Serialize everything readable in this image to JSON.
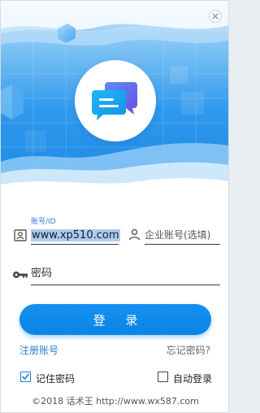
{
  "colors": {
    "accent": "#0a84e8",
    "hero_light": "#cfe8fb",
    "hero_mid": "#45aaf0",
    "hero_dark": "#1d7fd6"
  },
  "header": {
    "close_icon": "close-icon",
    "logo_icon": "chat-bubbles-icon"
  },
  "form": {
    "account_label": "账号/ID",
    "account_value": "www.xp510.com",
    "enterprise_placeholder": "企业账号(选填)",
    "password_placeholder": "密码",
    "account_icon": "contact-card-icon",
    "enterprise_icon": "person-icon",
    "password_icon": "key-icon"
  },
  "actions": {
    "login_label": "登 录",
    "register_link": "注册账号",
    "forgot_link": "忘记密码?"
  },
  "options": {
    "remember_label": "记住密码",
    "remember_checked": true,
    "auto_login_label": "自动登录",
    "auto_login_checked": false
  },
  "footer": {
    "copyright": "©2018 话术王 http://www.wx587.com"
  }
}
